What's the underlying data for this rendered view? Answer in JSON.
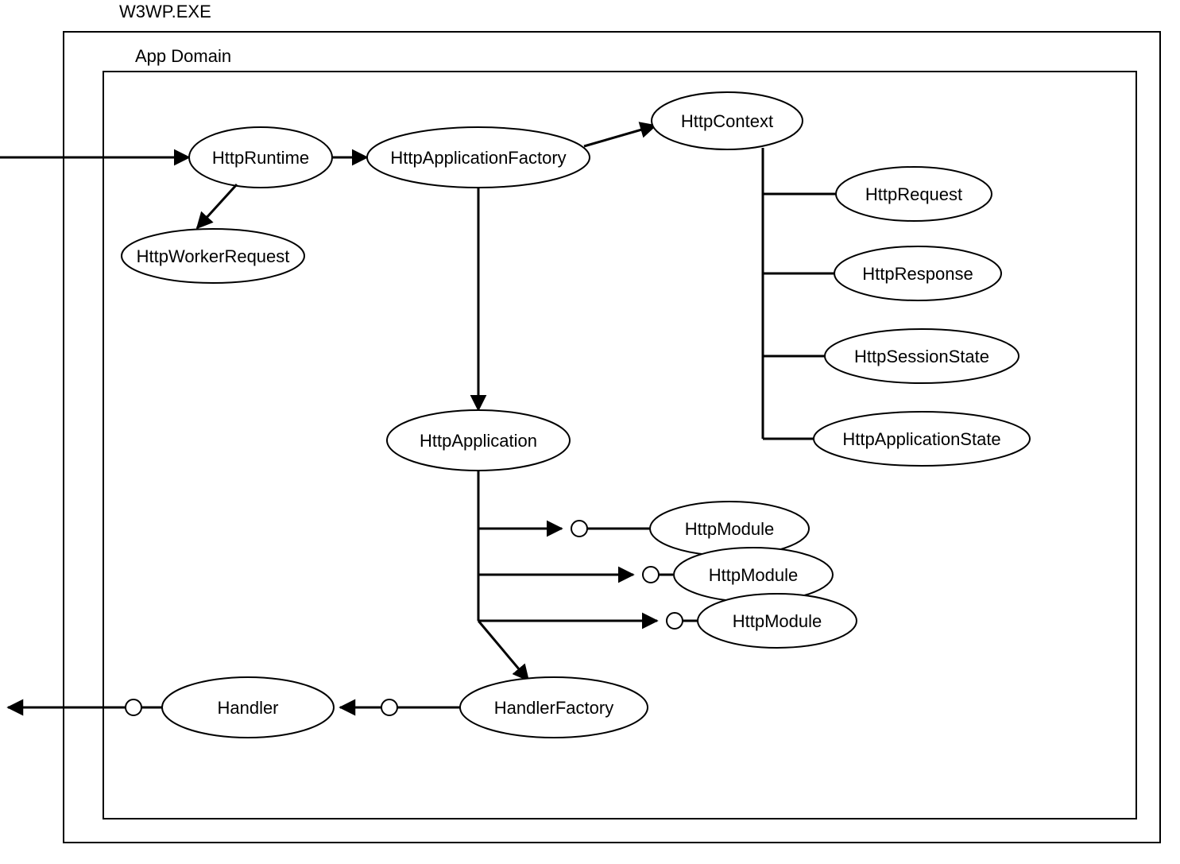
{
  "diagram": {
    "outer_title": "W3WP.EXE",
    "inner_title": "App Domain",
    "nodes": {
      "httpRuntime": "HttpRuntime",
      "httpWorkerRequest": "HttpWorkerRequest",
      "httpApplicationFactory": "HttpApplicationFactory",
      "httpContext": "HttpContext",
      "httpRequest": "HttpRequest",
      "httpResponse": "HttpResponse",
      "httpSessionState": "HttpSessionState",
      "httpApplicationState": "HttpApplicationState",
      "httpApplication": "HttpApplication",
      "httpModule1": "HttpModule",
      "httpModule2": "HttpModule",
      "httpModule3": "HttpModule",
      "handlerFactory": "HandlerFactory",
      "handler": "Handler"
    }
  }
}
